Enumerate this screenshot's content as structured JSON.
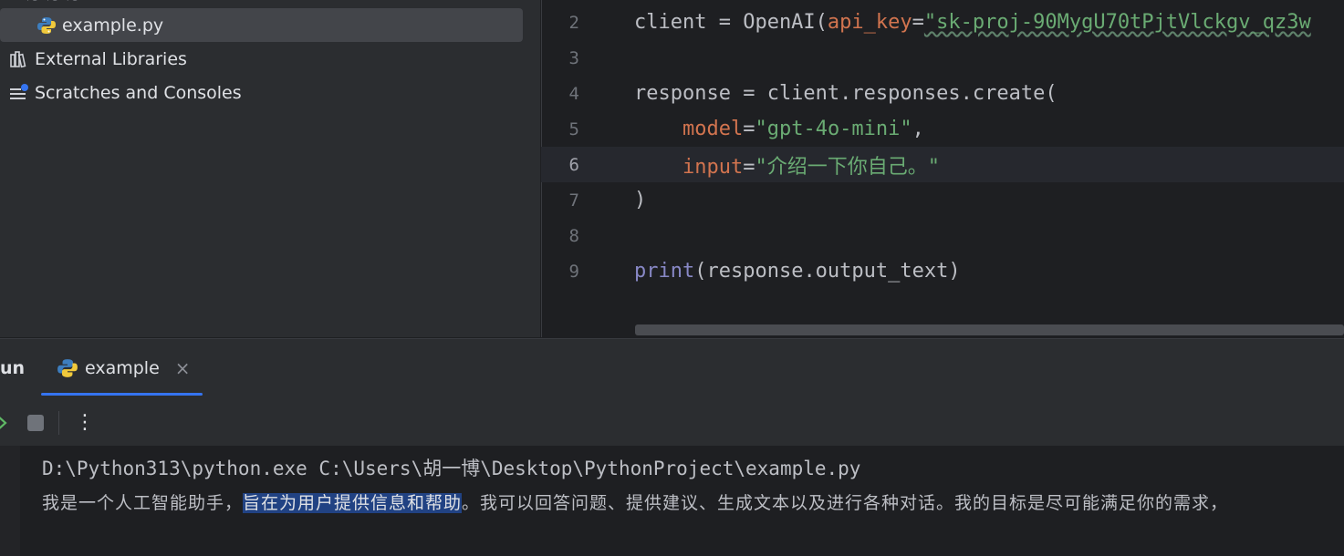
{
  "project_tree": {
    "items": [
      {
        "label": "example.py",
        "icon": "python-file-icon",
        "selected": true
      },
      {
        "label": "External Libraries",
        "icon": "library-icon"
      },
      {
        "label": "Scratches and Consoles",
        "icon": "scratches-icon"
      }
    ]
  },
  "editor": {
    "lines": [
      {
        "num": "2",
        "tokens": [
          {
            "t": "client = OpenAI(",
            "c": "plain"
          },
          {
            "t": "api_key",
            "c": "param"
          },
          {
            "t": "=",
            "c": "plain"
          },
          {
            "t": "\"sk-proj-90MygU70tPjtVlckgv_qz3w",
            "c": "str-squig"
          }
        ]
      },
      {
        "num": "3",
        "tokens": []
      },
      {
        "num": "4",
        "tokens": [
          {
            "t": "response = client.responses.create(",
            "c": "plain"
          }
        ]
      },
      {
        "num": "5",
        "tokens": [
          {
            "t": "    ",
            "c": "plain"
          },
          {
            "t": "model",
            "c": "param"
          },
          {
            "t": "=",
            "c": "plain"
          },
          {
            "t": "\"gpt-4o-mini\"",
            "c": "str"
          },
          {
            "t": ",",
            "c": "plain"
          }
        ]
      },
      {
        "num": "6",
        "tokens": [
          {
            "t": "    ",
            "c": "plain"
          },
          {
            "t": "input",
            "c": "param"
          },
          {
            "t": "=",
            "c": "plain"
          },
          {
            "t": "\"介绍一下你自己。\"",
            "c": "str"
          }
        ],
        "current": true
      },
      {
        "num": "7",
        "tokens": [
          {
            "t": ")",
            "c": "plain"
          }
        ]
      },
      {
        "num": "8",
        "tokens": []
      },
      {
        "num": "9",
        "tokens": [
          {
            "t": "print",
            "c": "builtin"
          },
          {
            "t": "(response.output_text)",
            "c": "plain"
          }
        ]
      }
    ]
  },
  "run": {
    "title": "un",
    "tab_label": "example",
    "tab_close": "×",
    "toolbar": {
      "rerun_icon": "rerun-icon",
      "stop_icon": "stop-icon",
      "more_label": "⋮"
    },
    "console": {
      "command": "D:\\Python313\\python.exe C:\\Users\\胡一博\\Desktop\\PythonProject\\example.py",
      "output_before": "我是一个人工智能助手，",
      "output_selected": "旨在为用户提供信息和帮助",
      "output_after": "。我可以回答问题、提供建议、生成文本以及进行各种对话。我的目标是尽可能满足你的需求，"
    }
  }
}
